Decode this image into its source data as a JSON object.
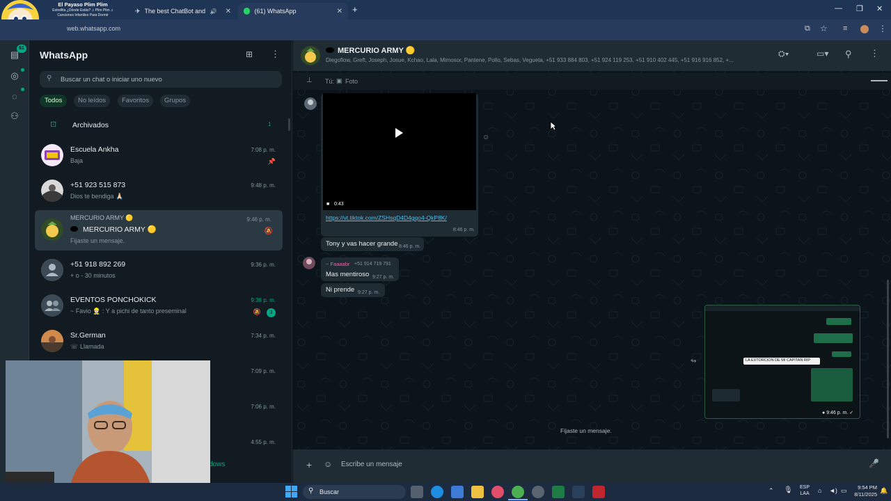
{
  "browser": {
    "media_title": "El Payaso Plim Plim",
    "media_subtitle_1": "Estrellita ¿Dónde Estás? ♫ Plim Plim ♫",
    "media_subtitle_2": "Canciones Infantiles Para Dormir",
    "tabs": [
      {
        "label": "The best ChatBot and Widg",
        "close": "✕"
      },
      {
        "label": "(61) WhatsApp",
        "close": "✕"
      }
    ],
    "new_tab": "+",
    "address": "web.whatsapp.com"
  },
  "sidebar": {
    "app_title": "WhatsApp",
    "rail_badge": "61",
    "search_placeholder": "Buscar un chat o iniciar uno nuevo",
    "filters": [
      "Todos",
      "No leídos",
      "Favoritos",
      "Grupos"
    ],
    "archived_label": "Archivados",
    "archived_count": "1",
    "chats": [
      {
        "name": "Escuela Ankha",
        "preview": "Baja",
        "time": "7:08 p. m."
      },
      {
        "name": "+51 923 515 873",
        "preview": "Dios te bendiga 🙏🏻",
        "time": "9:48 p. m."
      },
      {
        "name_top": "MERCURIO ARMY 🟡",
        "name": "MERCURIO ARMY 🟡",
        "preview": "Fijaste un mensaje.",
        "time": "9:46 p. m."
      },
      {
        "name": "+51 918 892 269",
        "preview": "+ o - 30 minutos",
        "time": "9:36 p. m."
      },
      {
        "name": "EVENTOS PONCHOKICK",
        "preview": "~ Favio 👷🏻 : Y a pichi de tanto preseminal",
        "time": "9:36 p. m.",
        "unread": "3"
      },
      {
        "name": "Sr.German",
        "preview": "Llamada",
        "time": "7:34 p. m."
      },
      {
        "time": "7:09 p. m."
      },
      {
        "time": "7:06 p. m."
      },
      {
        "time": "4:55 p. m."
      }
    ],
    "bottom_partial": "dows"
  },
  "chat": {
    "title": "MERCURIO ARMY 🟡",
    "members": "Diegoflow, Greft, Joseph, Josue, Kchao, Lala, Mimosor, Pantene, Pollo, Sebas, Vegueta, +51 933 884 803, +51 924 119 253, +51 910 402 445, +51 916 916 852, +...",
    "pinned_prefix": "Tú:",
    "pinned_label": "Foto",
    "video_duration": "0:43",
    "link": "https://vt.tiktok.com/ZSHsqD4D4gqo4-QkP8K/",
    "link_time": "8:46 p. m.",
    "messages": [
      {
        "text": "Tony y vas hacer grande",
        "time": "8:46 p. m."
      },
      {
        "sender": "~ Faaaabr",
        "sender_number": "+51 914 719 791",
        "text": "Mas mentiroso",
        "time": "9:27 p. m."
      },
      {
        "text": "Ni prende",
        "time": "9:27 p. m."
      }
    ],
    "system_message": "Fijaste un mensaje.",
    "preview_caption": "LA EXTORCION DE MI CAPITAN RIP",
    "preview_time": "9:46 p. m.",
    "composer_placeholder": "Escribe un mensaje"
  },
  "taskbar": {
    "search_label": "Buscar",
    "lang_1": "ESP",
    "lang_2": "LAA",
    "clock_time": "9:54 PM",
    "clock_date": "8/11/2025"
  },
  "colors": {
    "accent": "#00a884",
    "panel": "#111b21",
    "header": "#202c33",
    "chat_bg": "#0b141a",
    "bubble": "#1f2c33",
    "selected_filter": "#103529"
  }
}
